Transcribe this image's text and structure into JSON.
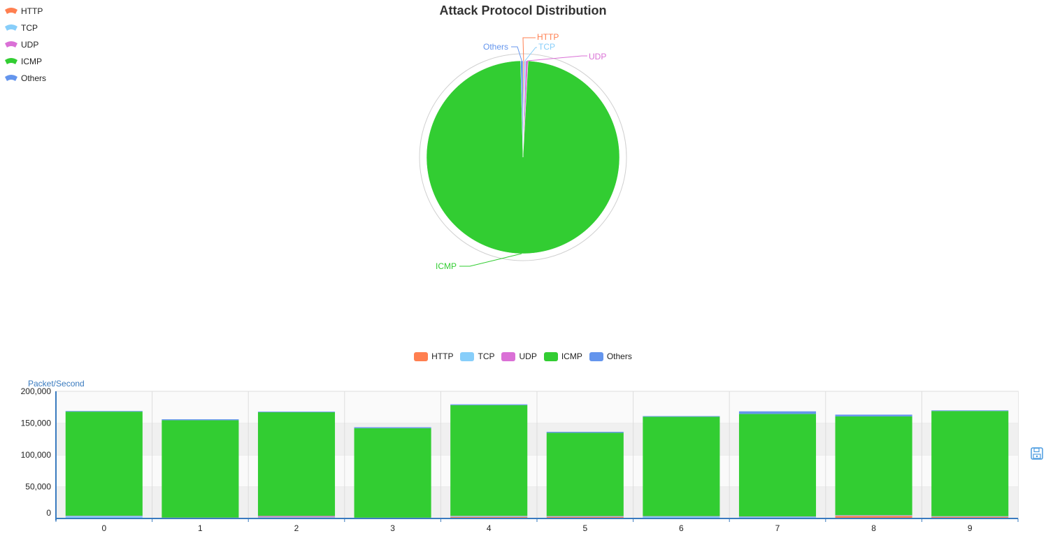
{
  "colors": {
    "HTTP": "#ff7f50",
    "TCP": "#87cefa",
    "UDP": "#da70d6",
    "ICMP": "#32cd32",
    "Others": "#6495ed"
  },
  "pie_legend": [
    "HTTP",
    "TCP",
    "UDP",
    "ICMP",
    "Others"
  ],
  "bar_legend": [
    "HTTP",
    "TCP",
    "UDP",
    "ICMP",
    "Others"
  ],
  "save_icon": "save-icon",
  "chart_data": [
    {
      "type": "pie",
      "title": "Attack Protocol Distribution",
      "labels": [
        "HTTP",
        "TCP",
        "UDP",
        "ICMP",
        "Others"
      ],
      "values": [
        0.2,
        0.25,
        0.4,
        98.75,
        0.4
      ],
      "legend": "top-left"
    },
    {
      "type": "bar",
      "stacked": true,
      "ylabel": "Packet/Second",
      "categories": [
        "0",
        "1",
        "2",
        "3",
        "4",
        "5",
        "6",
        "7",
        "8",
        "9"
      ],
      "yticks": [
        "0",
        "50,000",
        "100,000",
        "150,000",
        "200,000"
      ],
      "ylim": [
        0,
        200000
      ],
      "grid": true,
      "legend": "top-center",
      "series": [
        {
          "name": "HTTP",
          "values": [
            400,
            300,
            1500,
            700,
            2500,
            2500,
            600,
            1000,
            4000,
            2500
          ]
        },
        {
          "name": "TCP",
          "values": [
            3500,
            800,
            1000,
            300,
            1000,
            700,
            2800,
            1800,
            800,
            700
          ]
        },
        {
          "name": "UDP",
          "values": [
            400,
            300,
            1500,
            300,
            600,
            600,
            300,
            400,
            400,
            400
          ]
        },
        {
          "name": "ICMP",
          "values": [
            163700,
            153100,
            163000,
            140700,
            174100,
            131000,
            156300,
            161200,
            155300,
            165400
          ]
        },
        {
          "name": "Others",
          "values": [
            1000,
            1500,
            1000,
            1500,
            1300,
            1500,
            1000,
            4100,
            2800,
            1000
          ]
        }
      ]
    }
  ]
}
